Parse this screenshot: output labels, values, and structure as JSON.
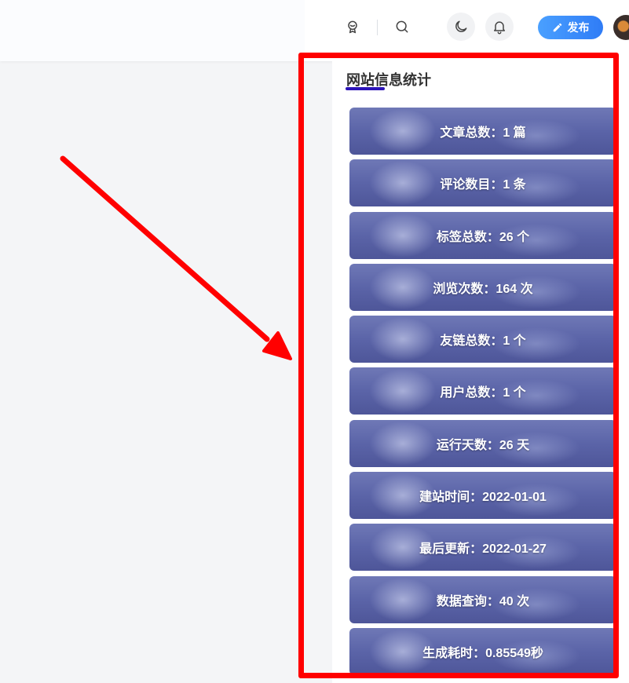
{
  "header": {
    "icons": {
      "medal": "medal-icon",
      "search": "search-icon",
      "theme": "moon-icon",
      "notify": "bell-icon",
      "publish": "pencil-icon"
    },
    "publish_label": "发布"
  },
  "widget": {
    "title": "网站信息统计",
    "stats": [
      "文章总数：1 篇",
      "评论数目：1 条",
      "标签总数：26 个",
      "浏览次数：164 次",
      "友链总数：1 个",
      "用户总数：1 个",
      "运行天数：26 天",
      "建站时间：2022-01-01",
      "最后更新：2022-01-27",
      "数据查询：40 次",
      "生成耗时：0.85549秒"
    ]
  },
  "colors": {
    "accent_underline": "#2c13b8",
    "publish_button": "#3a8ef8",
    "annotation": "#ff0000"
  }
}
